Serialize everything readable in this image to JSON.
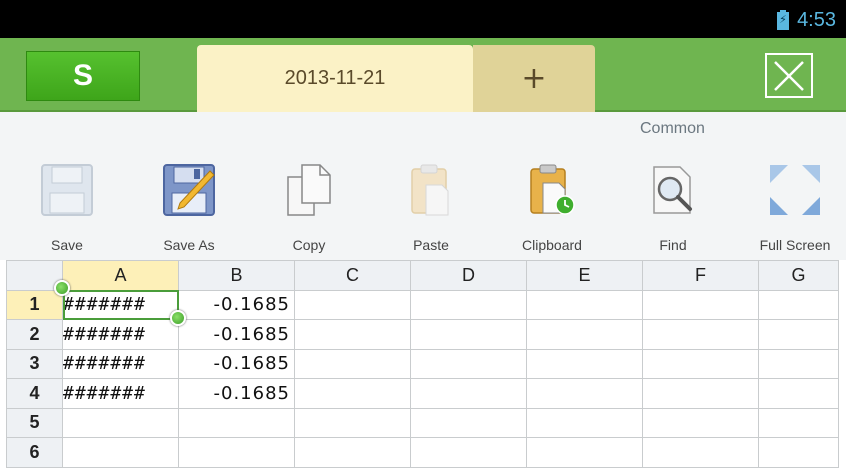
{
  "status_bar": {
    "time": "4:53",
    "battery_icon": "battery-charging-icon"
  },
  "header": {
    "logo_letter": "S",
    "tabs": [
      {
        "label": "2013-11-21"
      }
    ],
    "add_tab_label": "+",
    "close_icon": "close-icon"
  },
  "toolbar": {
    "category": "Common",
    "tools": [
      {
        "label": "Save",
        "icon": "save-icon"
      },
      {
        "label": "Save As",
        "icon": "save-as-icon"
      },
      {
        "label": "Copy",
        "icon": "copy-icon"
      },
      {
        "label": "Paste",
        "icon": "paste-icon"
      },
      {
        "label": "Clipboard",
        "icon": "clipboard-icon"
      },
      {
        "label": "Find",
        "icon": "find-icon"
      },
      {
        "label": "Full Screen",
        "icon": "full-screen-icon"
      }
    ]
  },
  "sheet": {
    "columns": [
      "A",
      "B",
      "C",
      "D",
      "E",
      "F",
      "G"
    ],
    "rows": [
      {
        "num": "1",
        "a": "#######",
        "b": "-0.1685"
      },
      {
        "num": "2",
        "a": "#######",
        "b": "-0.1685"
      },
      {
        "num": "3",
        "a": "#######",
        "b": "-0.1685"
      },
      {
        "num": "4",
        "a": "#######",
        "b": "-0.1685"
      },
      {
        "num": "5",
        "a": "",
        "b": ""
      },
      {
        "num": "6",
        "a": "",
        "b": ""
      }
    ]
  },
  "colors": {
    "header_green": "#6fb550",
    "tab_active": "#fbf2c6",
    "selection": "#4a9d3a"
  }
}
